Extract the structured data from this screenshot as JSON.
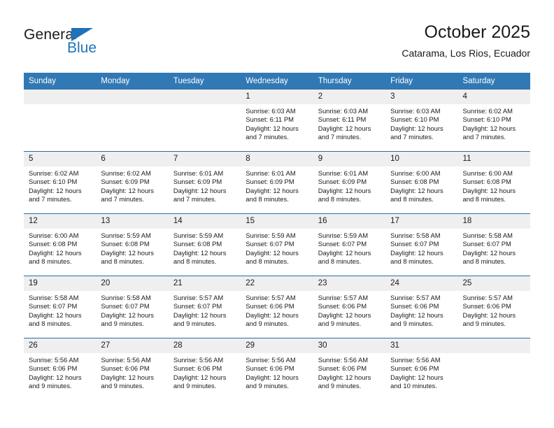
{
  "brand": {
    "name_part1": "General",
    "name_part2": "Blue",
    "logo_icon": "blue-triangle-icon"
  },
  "header": {
    "title": "October 2025",
    "subtitle": "Catarama, Los Rios, Ecuador"
  },
  "calendar": {
    "weekday_headers": [
      "Sunday",
      "Monday",
      "Tuesday",
      "Wednesday",
      "Thursday",
      "Friday",
      "Saturday"
    ],
    "header_bg_color": "#3179b5",
    "daynum_bg_color": "#efefef",
    "row_border_color": "#2e6da4",
    "weeks": [
      [
        {
          "day": "",
          "lines": []
        },
        {
          "day": "",
          "lines": []
        },
        {
          "day": "",
          "lines": []
        },
        {
          "day": "1",
          "lines": [
            "Sunrise: 6:03 AM",
            "Sunset: 6:11 PM",
            "Daylight: 12 hours",
            "and 7 minutes."
          ]
        },
        {
          "day": "2",
          "lines": [
            "Sunrise: 6:03 AM",
            "Sunset: 6:11 PM",
            "Daylight: 12 hours",
            "and 7 minutes."
          ]
        },
        {
          "day": "3",
          "lines": [
            "Sunrise: 6:03 AM",
            "Sunset: 6:10 PM",
            "Daylight: 12 hours",
            "and 7 minutes."
          ]
        },
        {
          "day": "4",
          "lines": [
            "Sunrise: 6:02 AM",
            "Sunset: 6:10 PM",
            "Daylight: 12 hours",
            "and 7 minutes."
          ]
        }
      ],
      [
        {
          "day": "5",
          "lines": [
            "Sunrise: 6:02 AM",
            "Sunset: 6:10 PM",
            "Daylight: 12 hours",
            "and 7 minutes."
          ]
        },
        {
          "day": "6",
          "lines": [
            "Sunrise: 6:02 AM",
            "Sunset: 6:09 PM",
            "Daylight: 12 hours",
            "and 7 minutes."
          ]
        },
        {
          "day": "7",
          "lines": [
            "Sunrise: 6:01 AM",
            "Sunset: 6:09 PM",
            "Daylight: 12 hours",
            "and 7 minutes."
          ]
        },
        {
          "day": "8",
          "lines": [
            "Sunrise: 6:01 AM",
            "Sunset: 6:09 PM",
            "Daylight: 12 hours",
            "and 8 minutes."
          ]
        },
        {
          "day": "9",
          "lines": [
            "Sunrise: 6:01 AM",
            "Sunset: 6:09 PM",
            "Daylight: 12 hours",
            "and 8 minutes."
          ]
        },
        {
          "day": "10",
          "lines": [
            "Sunrise: 6:00 AM",
            "Sunset: 6:08 PM",
            "Daylight: 12 hours",
            "and 8 minutes."
          ]
        },
        {
          "day": "11",
          "lines": [
            "Sunrise: 6:00 AM",
            "Sunset: 6:08 PM",
            "Daylight: 12 hours",
            "and 8 minutes."
          ]
        }
      ],
      [
        {
          "day": "12",
          "lines": [
            "Sunrise: 6:00 AM",
            "Sunset: 6:08 PM",
            "Daylight: 12 hours",
            "and 8 minutes."
          ]
        },
        {
          "day": "13",
          "lines": [
            "Sunrise: 5:59 AM",
            "Sunset: 6:08 PM",
            "Daylight: 12 hours",
            "and 8 minutes."
          ]
        },
        {
          "day": "14",
          "lines": [
            "Sunrise: 5:59 AM",
            "Sunset: 6:08 PM",
            "Daylight: 12 hours",
            "and 8 minutes."
          ]
        },
        {
          "day": "15",
          "lines": [
            "Sunrise: 5:59 AM",
            "Sunset: 6:07 PM",
            "Daylight: 12 hours",
            "and 8 minutes."
          ]
        },
        {
          "day": "16",
          "lines": [
            "Sunrise: 5:59 AM",
            "Sunset: 6:07 PM",
            "Daylight: 12 hours",
            "and 8 minutes."
          ]
        },
        {
          "day": "17",
          "lines": [
            "Sunrise: 5:58 AM",
            "Sunset: 6:07 PM",
            "Daylight: 12 hours",
            "and 8 minutes."
          ]
        },
        {
          "day": "18",
          "lines": [
            "Sunrise: 5:58 AM",
            "Sunset: 6:07 PM",
            "Daylight: 12 hours",
            "and 8 minutes."
          ]
        }
      ],
      [
        {
          "day": "19",
          "lines": [
            "Sunrise: 5:58 AM",
            "Sunset: 6:07 PM",
            "Daylight: 12 hours",
            "and 8 minutes."
          ]
        },
        {
          "day": "20",
          "lines": [
            "Sunrise: 5:58 AM",
            "Sunset: 6:07 PM",
            "Daylight: 12 hours",
            "and 9 minutes."
          ]
        },
        {
          "day": "21",
          "lines": [
            "Sunrise: 5:57 AM",
            "Sunset: 6:07 PM",
            "Daylight: 12 hours",
            "and 9 minutes."
          ]
        },
        {
          "day": "22",
          "lines": [
            "Sunrise: 5:57 AM",
            "Sunset: 6:06 PM",
            "Daylight: 12 hours",
            "and 9 minutes."
          ]
        },
        {
          "day": "23",
          "lines": [
            "Sunrise: 5:57 AM",
            "Sunset: 6:06 PM",
            "Daylight: 12 hours",
            "and 9 minutes."
          ]
        },
        {
          "day": "24",
          "lines": [
            "Sunrise: 5:57 AM",
            "Sunset: 6:06 PM",
            "Daylight: 12 hours",
            "and 9 minutes."
          ]
        },
        {
          "day": "25",
          "lines": [
            "Sunrise: 5:57 AM",
            "Sunset: 6:06 PM",
            "Daylight: 12 hours",
            "and 9 minutes."
          ]
        }
      ],
      [
        {
          "day": "26",
          "lines": [
            "Sunrise: 5:56 AM",
            "Sunset: 6:06 PM",
            "Daylight: 12 hours",
            "and 9 minutes."
          ]
        },
        {
          "day": "27",
          "lines": [
            "Sunrise: 5:56 AM",
            "Sunset: 6:06 PM",
            "Daylight: 12 hours",
            "and 9 minutes."
          ]
        },
        {
          "day": "28",
          "lines": [
            "Sunrise: 5:56 AM",
            "Sunset: 6:06 PM",
            "Daylight: 12 hours",
            "and 9 minutes."
          ]
        },
        {
          "day": "29",
          "lines": [
            "Sunrise: 5:56 AM",
            "Sunset: 6:06 PM",
            "Daylight: 12 hours",
            "and 9 minutes."
          ]
        },
        {
          "day": "30",
          "lines": [
            "Sunrise: 5:56 AM",
            "Sunset: 6:06 PM",
            "Daylight: 12 hours",
            "and 9 minutes."
          ]
        },
        {
          "day": "31",
          "lines": [
            "Sunrise: 5:56 AM",
            "Sunset: 6:06 PM",
            "Daylight: 12 hours",
            "and 10 minutes."
          ]
        },
        {
          "day": "",
          "lines": []
        }
      ]
    ]
  }
}
